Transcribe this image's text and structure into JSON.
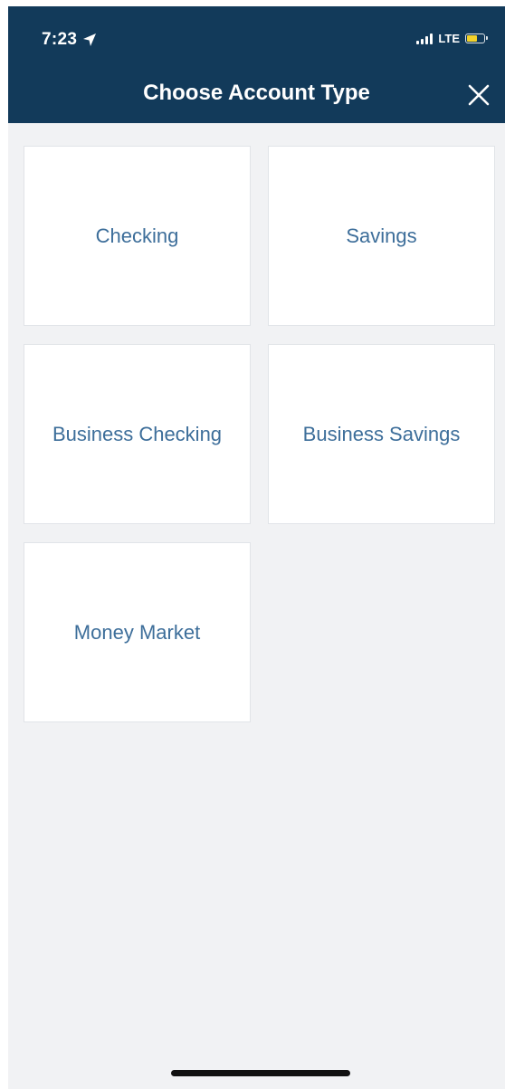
{
  "status_bar": {
    "time": "7:23",
    "network": "LTE",
    "location_icon": "location-arrow-icon",
    "battery_color": "#f3d22a"
  },
  "header": {
    "title": "Choose Account Type",
    "close_icon": "close-icon",
    "background": "#123a5a"
  },
  "account_types": [
    {
      "label": "Checking"
    },
    {
      "label": "Savings"
    },
    {
      "label": "Business Checking"
    },
    {
      "label": "Business Savings"
    },
    {
      "label": "Money Market"
    }
  ],
  "colors": {
    "tile_text": "#3d6e9a",
    "page_background": "#f1f2f4"
  }
}
